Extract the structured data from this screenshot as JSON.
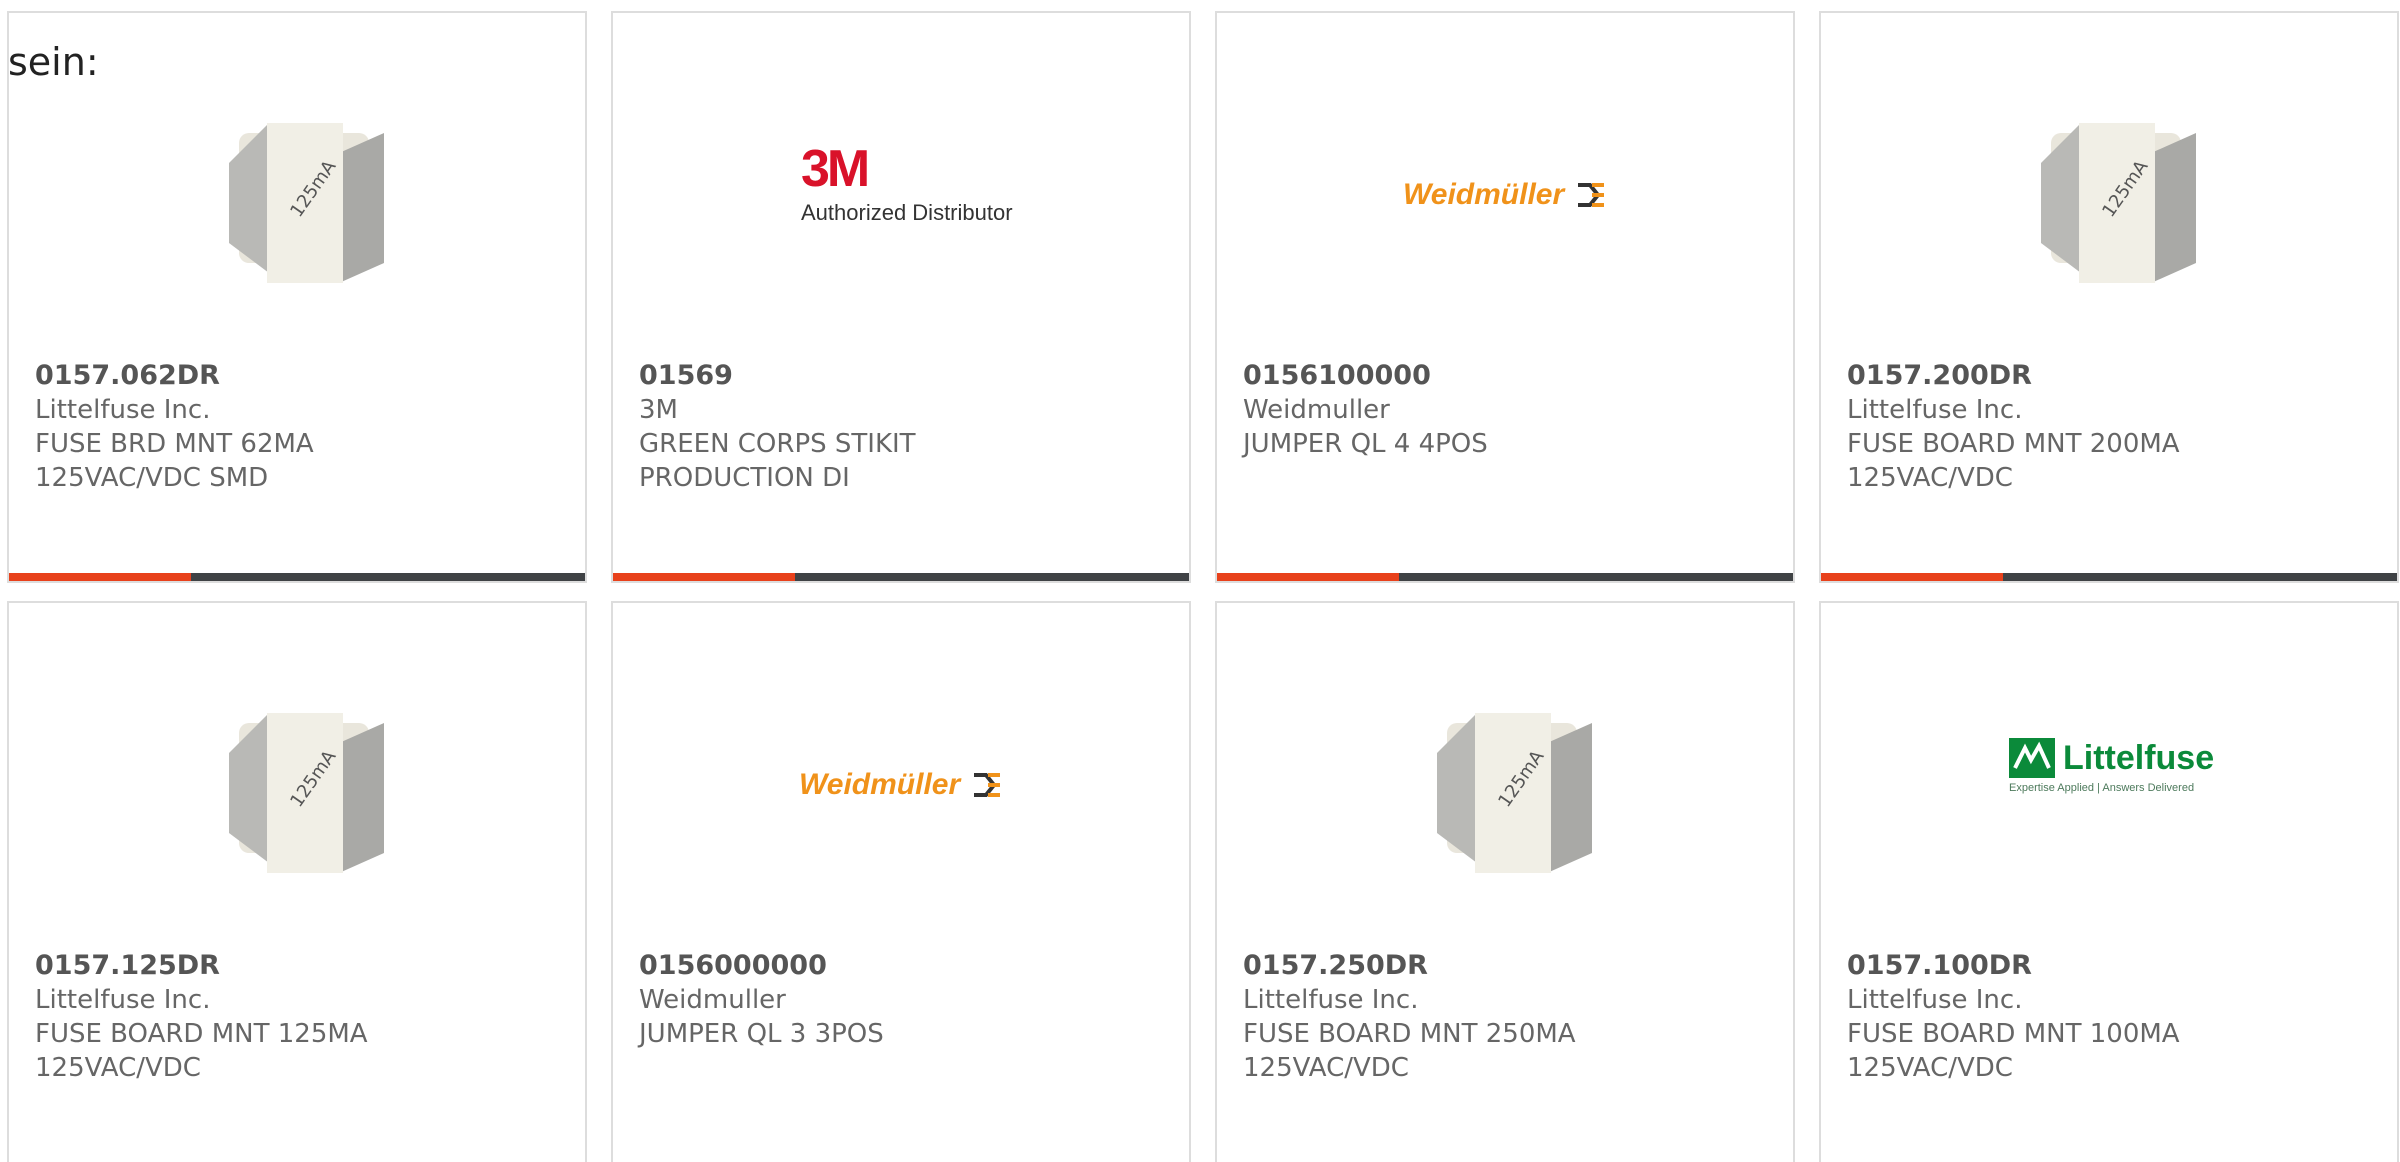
{
  "intro_text": "sein:",
  "products": [
    {
      "part_number": "0157.062DR",
      "manufacturer": "Littelfuse Inc.",
      "description_line1": "FUSE BRD MNT 62MA",
      "description_line2": "125VAC/VDC SMD",
      "image": "fuse-photo",
      "fuse_label": "125mA"
    },
    {
      "part_number": "01569",
      "manufacturer": "3M",
      "description_line1": "GREEN CORPS STIKIT",
      "description_line2": "PRODUCTION DI",
      "image": "3m-logo",
      "logo_mark": "3M",
      "logo_sub": "Authorized Distributor"
    },
    {
      "part_number": "0156100000",
      "manufacturer": "Weidmuller",
      "description_line1": "JUMPER QL 4 4POS",
      "description_line2": "",
      "image": "weidmuller-logo",
      "logo_word": "Weidmüller"
    },
    {
      "part_number": "0157.200DR",
      "manufacturer": "Littelfuse Inc.",
      "description_line1": "FUSE BOARD MNT 200MA",
      "description_line2": "125VAC/VDC",
      "image": "fuse-photo",
      "fuse_label": "125mA"
    },
    {
      "part_number": "0157.125DR",
      "manufacturer": "Littelfuse Inc.",
      "description_line1": "FUSE BOARD MNT 125MA",
      "description_line2": "125VAC/VDC",
      "image": "fuse-photo",
      "fuse_label": "125mA"
    },
    {
      "part_number": "0156000000",
      "manufacturer": "Weidmuller",
      "description_line1": "JUMPER QL 3 3POS",
      "description_line2": "",
      "image": "weidmuller-logo",
      "logo_word": "Weidmüller"
    },
    {
      "part_number": "0157.250DR",
      "manufacturer": "Littelfuse Inc.",
      "description_line1": "FUSE BOARD MNT 250MA",
      "description_line2": "125VAC/VDC",
      "image": "fuse-photo",
      "fuse_label": "125mA"
    },
    {
      "part_number": "0157.100DR",
      "manufacturer": "Littelfuse Inc.",
      "description_line1": "FUSE BOARD MNT 100MA",
      "description_line2": "125VAC/VDC",
      "image": "littelfuse-logo",
      "logo_word": "Littelfuse",
      "logo_tagline": "Expertise Applied | Answers Delivered"
    }
  ],
  "colors": {
    "accent_bar": "#e8411b",
    "bar_base": "#3f4245",
    "card_border": "#dddddd",
    "text": "#666666"
  }
}
